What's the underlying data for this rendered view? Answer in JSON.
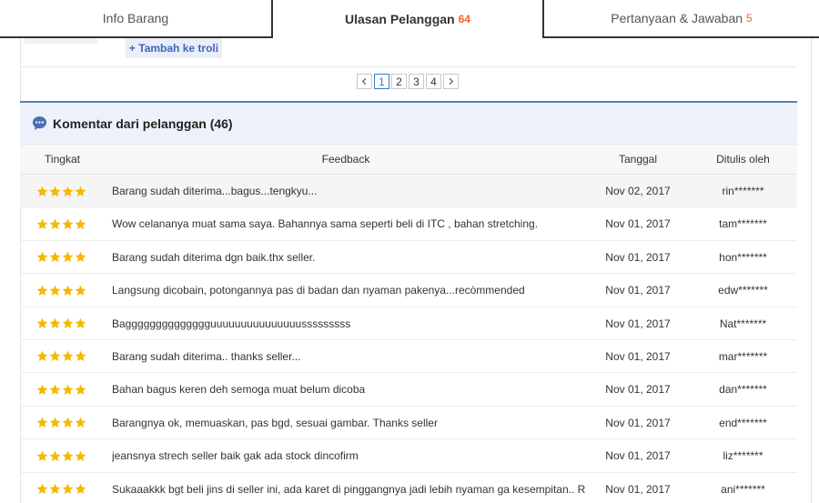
{
  "tabs": [
    {
      "label": "Info Barang",
      "count": ""
    },
    {
      "label": "Ulasan Pelanggan",
      "count": "64"
    },
    {
      "label": "Pertanyaan & Jawaban",
      "count": "5"
    }
  ],
  "cart": {
    "add_label": "+ Tambah ke troli"
  },
  "pagination": {
    "pages": [
      "1",
      "2",
      "3",
      "4"
    ],
    "current": "1"
  },
  "comments": {
    "title": "Komentar dari pelanggan (46)",
    "icon": "chat-bubble-icon",
    "headers": {
      "rating": "Tingkat",
      "feedback": "Feedback",
      "date": "Tanggal",
      "author": "Ditulis oleh"
    },
    "rows": [
      {
        "rating": 4,
        "feedback": "Barang sudah diterima...bagus...tengkyu...",
        "date": "Nov 02, 2017",
        "author": "rin*******"
      },
      {
        "rating": 4,
        "feedback": "Wow celananya muat sama saya. Bahannya sama seperti beli di ITC , bahan stretching.",
        "date": "Nov 01, 2017",
        "author": "tam*******"
      },
      {
        "rating": 4,
        "feedback": "Barang sudah diterima dgn baik.thx seller.",
        "date": "Nov 01, 2017",
        "author": "hon*******"
      },
      {
        "rating": 4,
        "feedback": "Langsung dicobain, potongannya pas di badan dan nyaman pakenya...recòmmended",
        "date": "Nov 01, 2017",
        "author": "edw*******"
      },
      {
        "rating": 4,
        "feedback": "Bagggggggggggggguuuuuuuuuuuuuuusssssssss",
        "date": "Nov 01, 2017",
        "author": "Nat*******"
      },
      {
        "rating": 4,
        "feedback": "Barang sudah diterima.. thanks seller...",
        "date": "Nov 01, 2017",
        "author": "mar*******"
      },
      {
        "rating": 4,
        "feedback": "Bahan bagus keren deh semoga muat belum dicoba",
        "date": "Nov 01, 2017",
        "author": "dan*******"
      },
      {
        "rating": 4,
        "feedback": "Barangnya ok, memuaskan, pas bgd, sesuai gambar. Thanks seller",
        "date": "Nov 01, 2017",
        "author": "end*******"
      },
      {
        "rating": 4,
        "feedback": "jeansnya strech seller baik gak ada stock dincofirm",
        "date": "Nov 01, 2017",
        "author": "liz*******"
      },
      {
        "rating": 4,
        "feedback": "Sukaaakkk bgt beli jins di seller ini, ada karet di pinggangnya jadi lebih nyaman ga kesempitan.. Recom...",
        "date": "Nov 01, 2017",
        "author": "ani*******"
      }
    ]
  },
  "colors": {
    "star": "#f5b800",
    "accent": "#3a78c9",
    "count": "#f0642d"
  }
}
